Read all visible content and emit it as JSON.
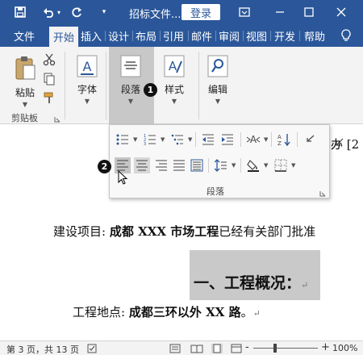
{
  "titlebar": {
    "doc_title": "招标文件....",
    "login_label": "登录"
  },
  "tabs": [
    "文件",
    "开始",
    "插入",
    "设计",
    "布局",
    "引用",
    "邮件",
    "审阅",
    "视图",
    "开发",
    "帮助"
  ],
  "active_tab": "开始",
  "ribbon": {
    "paste_label": "粘贴",
    "clipboard_group": "剪贴板",
    "font_label": "字体",
    "paragraph_label": "段落",
    "styles_label": "样式",
    "edit_label": "编辑"
  },
  "paragraph_panel": {
    "title": "段落"
  },
  "document": {
    "header_fragment": "办 [2",
    "line1_prefix": "建设项目:",
    "line1_bold": "成都 XXX 市场工程",
    "line1_rest": "已经有关部门批准",
    "heading": "一、工程概况：",
    "line2_prefix": "工程地点:",
    "line2_bold": "成都三环以外 XX 路",
    "line2_end": "。"
  },
  "annotations": [
    "1",
    "2"
  ],
  "statusbar": {
    "page_info": "第 3 页，共 13 页",
    "zoom_minus": "-",
    "zoom_plus": "+",
    "zoom": "100%"
  },
  "colors": {
    "accent": "#2b579a",
    "ribbon_bg": "#f3f3f3",
    "heading_highlight": "#c9c9c9"
  }
}
